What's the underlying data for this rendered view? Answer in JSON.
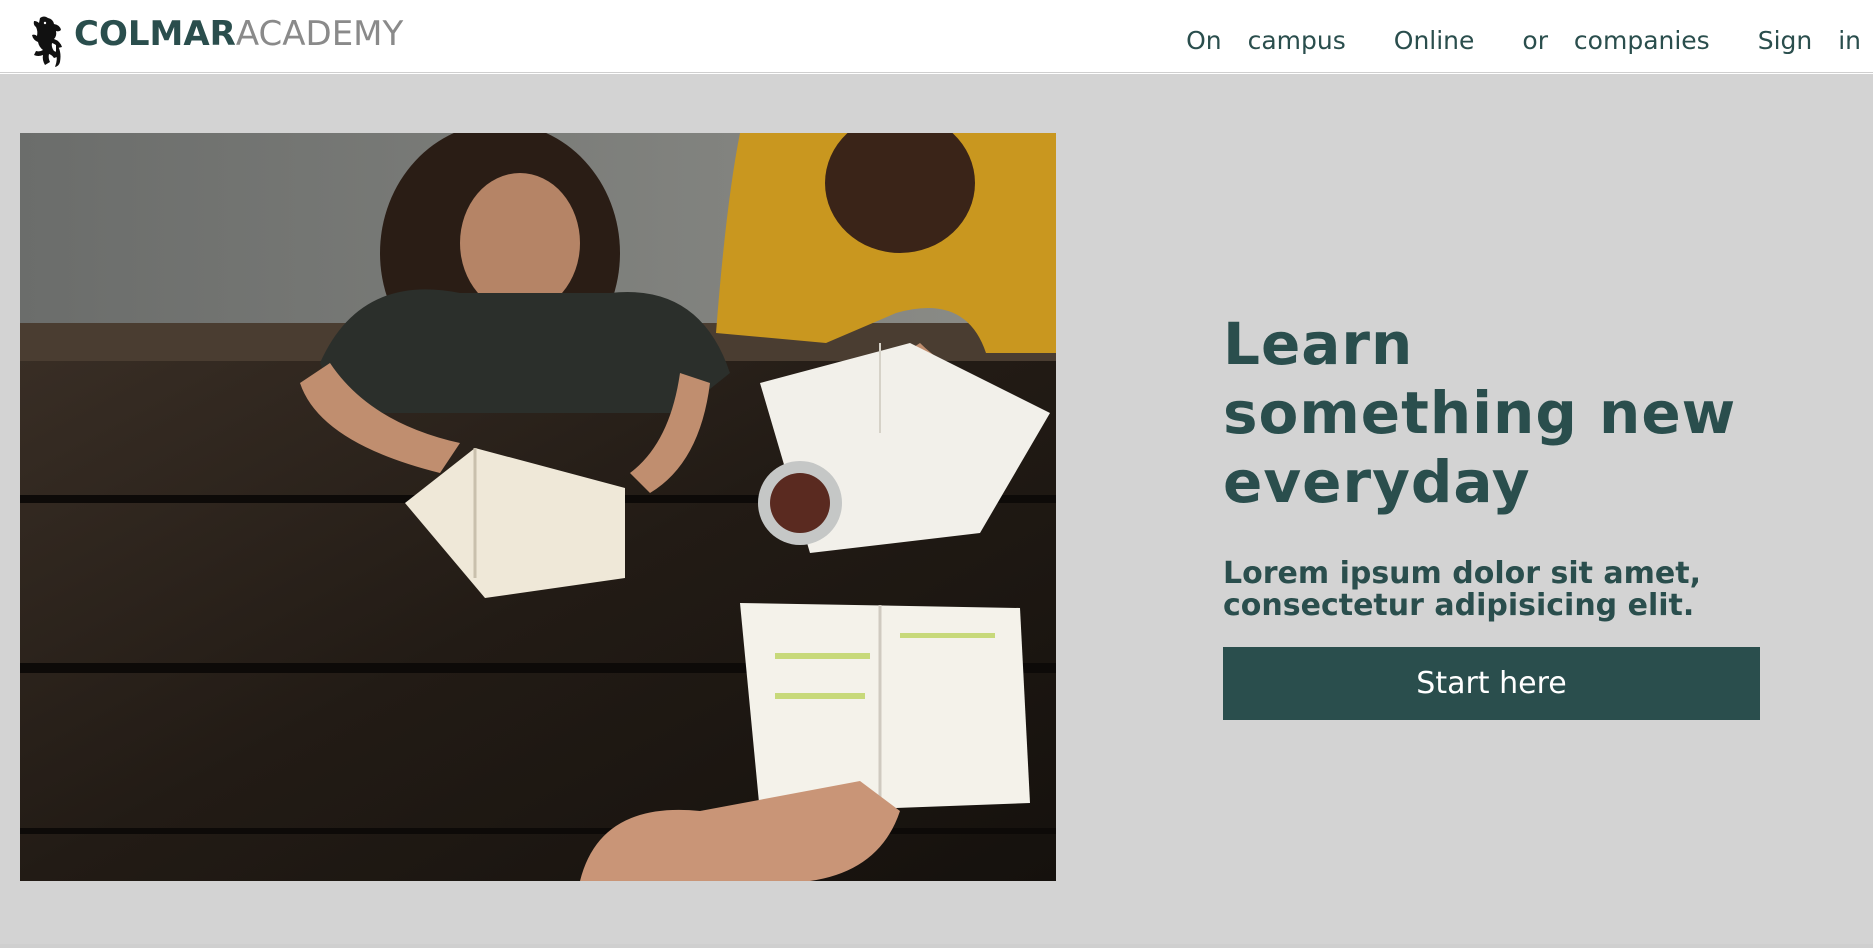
{
  "header": {
    "brand": {
      "strong": "COLMAR",
      "light": "ACADEMY",
      "logo_icon": "lion-rampant-icon"
    },
    "nav": [
      {
        "label": "On campus"
      },
      {
        "label": "Online"
      },
      {
        "label": "or companies"
      },
      {
        "label": "Sign in"
      }
    ]
  },
  "hero": {
    "image": "students-studying-at-picnic-table-photo",
    "headline": "Learn something new everyday",
    "subheadline": "Lorem ipsum dolor sit amet, consectetur adipisicing elit.",
    "cta_label": "Start here"
  },
  "colors": {
    "brand_primary": "#2a4e4d",
    "brand_secondary": "#8a8a8a",
    "hero_background": "#d3d3d3",
    "button_text": "#ffffff"
  }
}
